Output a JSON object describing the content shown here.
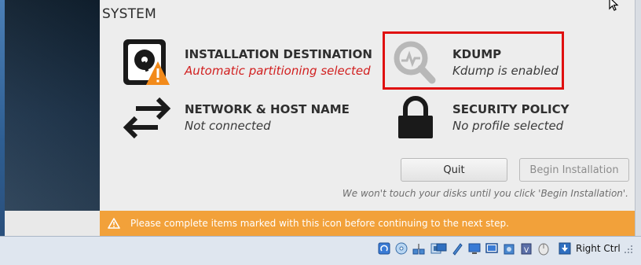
{
  "hub": {
    "section_title": "SYSTEM",
    "spokes": [
      {
        "name": "INSTALLATION DESTINATION",
        "status": "Automatic partitioning selected",
        "icon": "hard-disk-warning-icon"
      },
      {
        "name": "KDUMP",
        "status": "Kdump is enabled",
        "icon": "kdump-magnifier-icon"
      },
      {
        "name": "NETWORK & HOST NAME",
        "status": "Not connected",
        "icon": "network-arrows-icon"
      },
      {
        "name": "SECURITY POLICY",
        "status": "No profile selected",
        "icon": "lock-icon"
      }
    ]
  },
  "actions": {
    "quit_label": "Quit",
    "begin_label": "Begin Installation",
    "disclaimer": "We won't touch your disks until you click 'Begin Installation'."
  },
  "warning_bar": {
    "message": "Please complete items marked with this icon before continuing to the next step."
  },
  "taskbar": {
    "host_key": "Right Ctrl"
  },
  "colors": {
    "warning": "#f2a13a",
    "error_text": "#d11f1f",
    "highlight": "#e01010"
  }
}
